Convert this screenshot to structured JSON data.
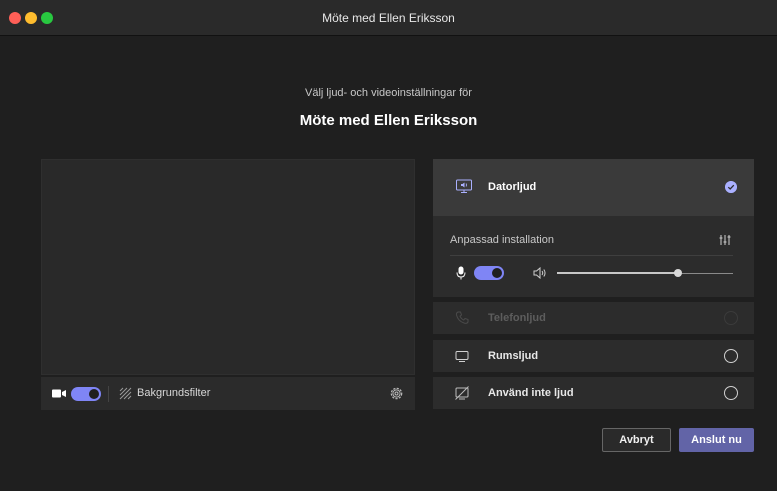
{
  "window": {
    "title": "Möte med Ellen Eriksson"
  },
  "header": {
    "subtitle": "Välj ljud- och videoinställningar för",
    "meeting_title": "Möte med Ellen  Eriksson"
  },
  "video": {
    "camera_enabled": true,
    "background_filter_label": "Bakgrundsfilter"
  },
  "audio": {
    "selected_option": {
      "label": "Datorljud",
      "icon": "computer-audio-icon",
      "selected": true
    },
    "custom_setup_label": "Anpassad installation",
    "mic_enabled": true,
    "speaker_volume_fraction": 0.69,
    "other_options": [
      {
        "label": "Telefonljud",
        "icon": "phone-audio-icon",
        "disabled": true
      },
      {
        "label": "Rumsljud",
        "icon": "room-audio-icon",
        "disabled": false
      },
      {
        "label": "Använd inte ljud",
        "icon": "no-audio-icon",
        "disabled": false
      }
    ]
  },
  "actions": {
    "cancel_label": "Avbryt",
    "join_label": "Anslut nu"
  },
  "colors": {
    "accent": "#7f85f5",
    "primary_button": "#6264a7",
    "background": "#1f1f1f"
  }
}
